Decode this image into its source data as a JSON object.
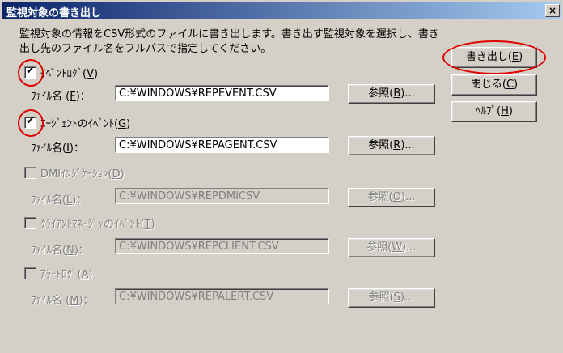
{
  "window": {
    "title": "監視対象の書き出し",
    "close_label": "×"
  },
  "description": "監視対象の情報をCSV形式のファイルに書き出します。書き出す監視対象を選択し、書き出し先のファイル名をフルパスで指定してください。",
  "buttons": {
    "export": {
      "text": "書き出し(",
      "key": "E",
      "end": ")"
    },
    "close": {
      "text": "閉じる(",
      "key": "C",
      "end": ")"
    },
    "help": {
      "text": "ﾍﾙﾌﾟ(",
      "key": "H",
      "end": ")"
    }
  },
  "sections": [
    {
      "check_label": "ｲﾍﾞﾝﾄﾛｸﾞ(",
      "check_key": "V",
      "checked": true,
      "enabled": true,
      "file_label": "ﾌｧｲﾙ名 (",
      "file_key": "F",
      "file_end": ")：",
      "path": "C:¥WINDOWS¥REPEVENT.CSV",
      "browse_text": "参照(",
      "browse_key": "B",
      "browse_end": ")..."
    },
    {
      "check_label": "ｴｰｼﾞｪﾝﾄのｲﾍﾞﾝﾄ(",
      "check_key": "G",
      "checked": true,
      "enabled": true,
      "file_label": "ﾌｧｲﾙ名(",
      "file_key": "I",
      "file_end": ")：",
      "path": "C:¥WINDOWS¥REPAGENT.CSV",
      "browse_text": "参照(",
      "browse_key": "R",
      "browse_end": ")..."
    },
    {
      "check_label": "DMIｲﾝｼﾞｹｰｼｮﾝ(",
      "check_key": "D",
      "checked": false,
      "enabled": false,
      "file_label": "ﾌｧｲﾙ名(",
      "file_key": "L",
      "file_end": ")：",
      "path": "C:¥WINDOWS¥REPDMICSV",
      "browse_text": "参照(",
      "browse_key": "O",
      "browse_end": ")..."
    },
    {
      "check_label": "ｸﾗｲｱﾝﾄﾏﾈｰｼﾞｬのｲﾍﾞﾝﾄ(",
      "check_key": "T",
      "checked": false,
      "enabled": false,
      "file_label": "ﾌｧｲﾙ名(",
      "file_key": "N",
      "file_end": ")：",
      "path": "C:¥WINDOWS¥REPCLIENT.CSV",
      "browse_text": "参照(",
      "browse_key": "W",
      "browse_end": ")..."
    },
    {
      "check_label": "ｱﾗｰﾄﾛｸﾞ(",
      "check_key": "A",
      "checked": false,
      "enabled": false,
      "file_label": "ﾌｧｲﾙ名 (",
      "file_key": "M",
      "file_end": ")：",
      "path": "C:¥WINDOWS¥REPALERT.CSV",
      "browse_text": "参照(",
      "browse_key": "S",
      "browse_end": ")..."
    }
  ],
  "colors": {
    "title_bar": "#0a246a",
    "highlight_circle": "#e00000",
    "dialog_bg": "#d4d0c8"
  }
}
